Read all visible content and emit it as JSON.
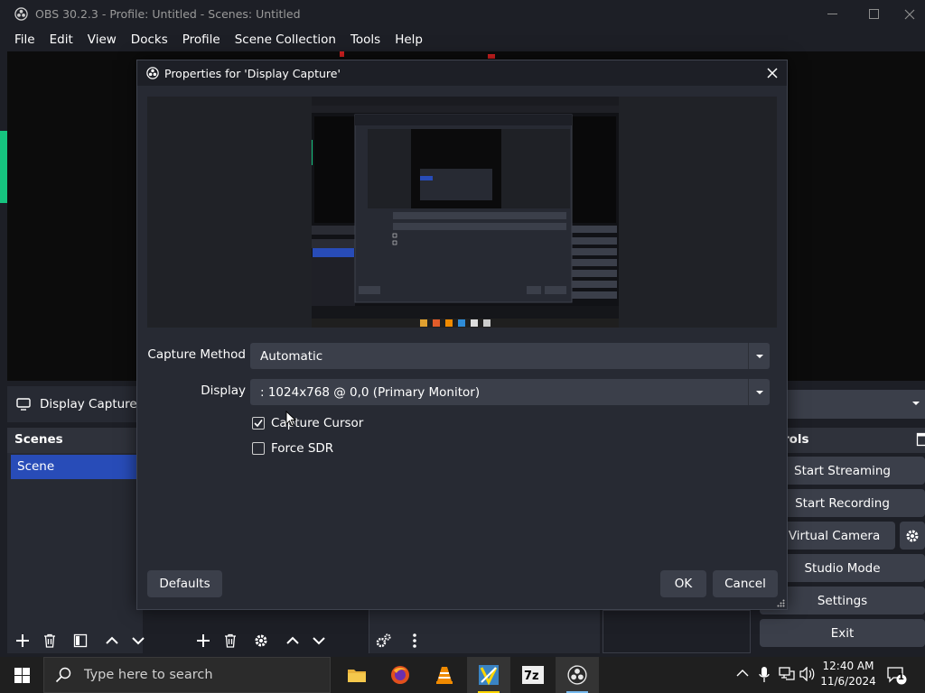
{
  "window": {
    "title": "OBS 30.2.3 - Profile: Untitled - Scenes: Untitled",
    "minimize_icon": "minimize-icon",
    "maximize_icon": "maximize-icon",
    "close_icon": "close-icon"
  },
  "menu": {
    "items": [
      "File",
      "Edit",
      "View",
      "Docks",
      "Profile",
      "Scene Collection",
      "Tools",
      "Help"
    ]
  },
  "main": {
    "source_label": "Display Capture",
    "scenes_dock_title": "Scenes",
    "scenes": [
      "Scene"
    ],
    "controls_title_visible": "rols",
    "controls": {
      "start_streaming": "Start Streaming",
      "start_recording": "Start Recording",
      "virtual_camera": "rt Virtual Camera",
      "studio_mode": "Studio Mode",
      "settings": "Settings",
      "exit": "Exit"
    }
  },
  "dialog": {
    "title": "Properties for 'Display Capture'",
    "capture_method_label": "Capture Method",
    "capture_method_value": "Automatic",
    "display_label": "Display",
    "display_value": ": 1024x768 @ 0,0 (Primary Monitor)",
    "capture_cursor_label": "Capture Cursor",
    "capture_cursor_checked": true,
    "force_sdr_label": "Force SDR",
    "force_sdr_checked": false,
    "defaults_button": "Defaults",
    "ok_button": "OK",
    "cancel_button": "Cancel"
  },
  "taskbar": {
    "search_placeholder": "Type here to search",
    "apps": [
      "file-explorer",
      "firefox",
      "vlc",
      "kate-editor",
      "7-zip",
      "obs-studio"
    ],
    "time": "12:40 AM",
    "date": "11/6/2024",
    "notification_count": "1"
  },
  "colors": {
    "accent": "#284cb8",
    "background": "#1d1f26",
    "panel": "#272a33",
    "button": "#3b3f4a"
  }
}
